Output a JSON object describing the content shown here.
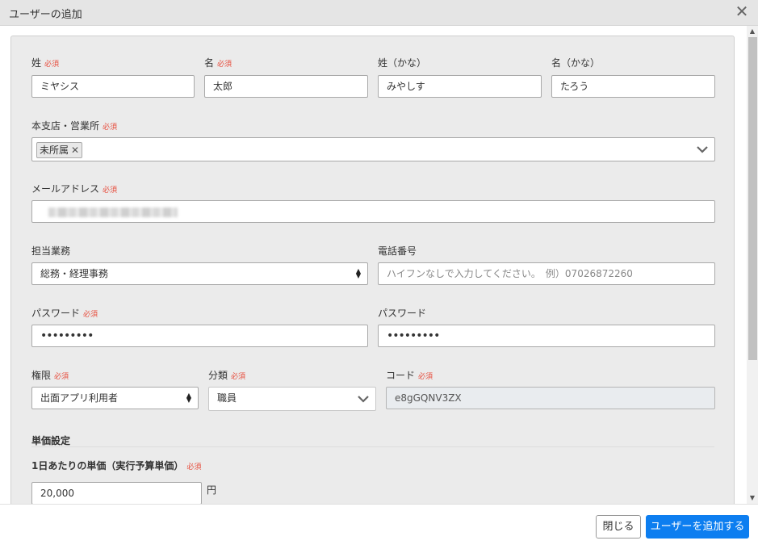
{
  "dialog": {
    "title": "ユーザーの追加",
    "close_symbol": "✕"
  },
  "required_label": "必須",
  "form": {
    "last_name": {
      "label": "姓",
      "value": "ミヤシス"
    },
    "first_name": {
      "label": "名",
      "value": "太郎"
    },
    "last_name_kana": {
      "label": "姓（かな）",
      "value": "みやしす"
    },
    "first_name_kana": {
      "label": "名（かな）",
      "value": "たろう"
    },
    "branch": {
      "label": "本支店・営業所",
      "tag": "未所属"
    },
    "email": {
      "label": "メールアドレス"
    },
    "duty": {
      "label": "担当業務",
      "value": "総務・経理事務"
    },
    "phone": {
      "label": "電話番号",
      "placeholder": "ハイフンなしで入力してください。　例）07026872260"
    },
    "password": {
      "label": "パスワード",
      "value": "•••••••••"
    },
    "password_confirm": {
      "label": "パスワード",
      "value": "•••••••••"
    },
    "role": {
      "label": "権限",
      "value": "出面アプリ利用者"
    },
    "category": {
      "label": "分類",
      "value": "職員"
    },
    "code": {
      "label": "コード",
      "value": "e8gGQNV3ZX"
    },
    "unit_price_section": {
      "title": "単価設定"
    },
    "daily_price": {
      "label": "1日あたりの単価（実行予算単価）",
      "value": "20,000",
      "unit": "円"
    }
  },
  "footer": {
    "close_label": "閉じる",
    "add_label": "ユーザーを追加する"
  }
}
